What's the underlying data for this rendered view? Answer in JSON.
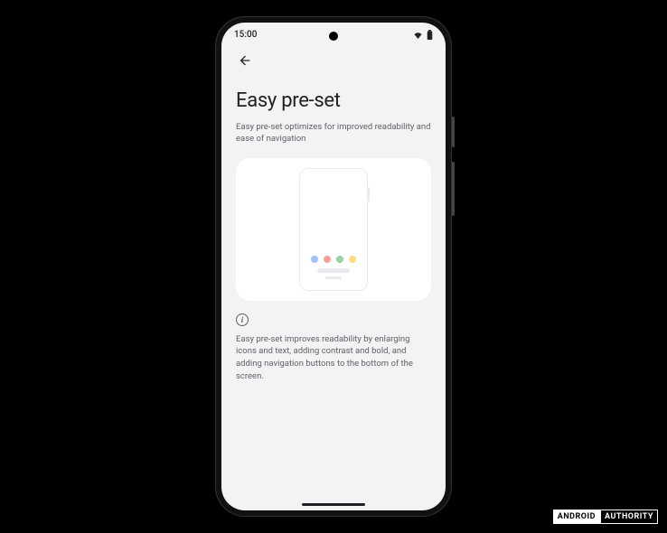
{
  "status": {
    "time": "15:00"
  },
  "page": {
    "title": "Easy pre-set",
    "subtitle": "Easy pre-set optimizes for improved readability and ease of navigation",
    "description": "Easy pre-set improves readability by enlarging icons and text, adding contrast and bold, and adding navigation buttons to the bottom of the screen."
  },
  "watermark": {
    "left": "ANDROID",
    "right": "AUTHORITY"
  }
}
